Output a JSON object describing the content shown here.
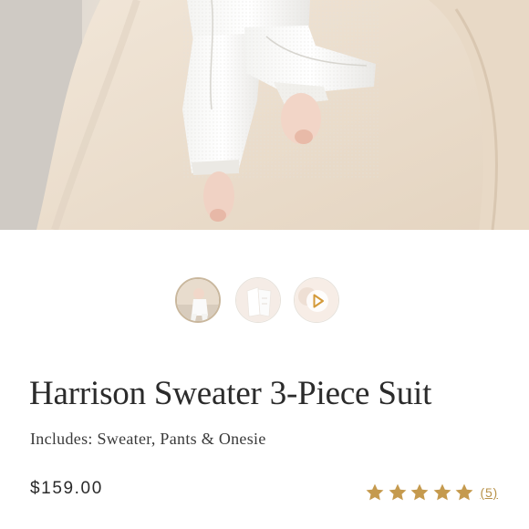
{
  "product": {
    "title": "Harrison Sweater 3-Piece Suit",
    "subtitle": "Includes: Sweater, Pants & Onesie",
    "price": "$159.00",
    "rating": {
      "stars": 5,
      "max": 5,
      "review_count_label": "(5)"
    }
  },
  "gallery": {
    "thumbnails": [
      {
        "kind": "photo",
        "active": true
      },
      {
        "kind": "photo",
        "active": false
      },
      {
        "kind": "video",
        "active": false
      }
    ]
  },
  "colors": {
    "star": "#c59a4e",
    "review_link": "#b8924a",
    "play_icon": "#d49a3a",
    "active_thumb_border": "#c9b79d"
  }
}
